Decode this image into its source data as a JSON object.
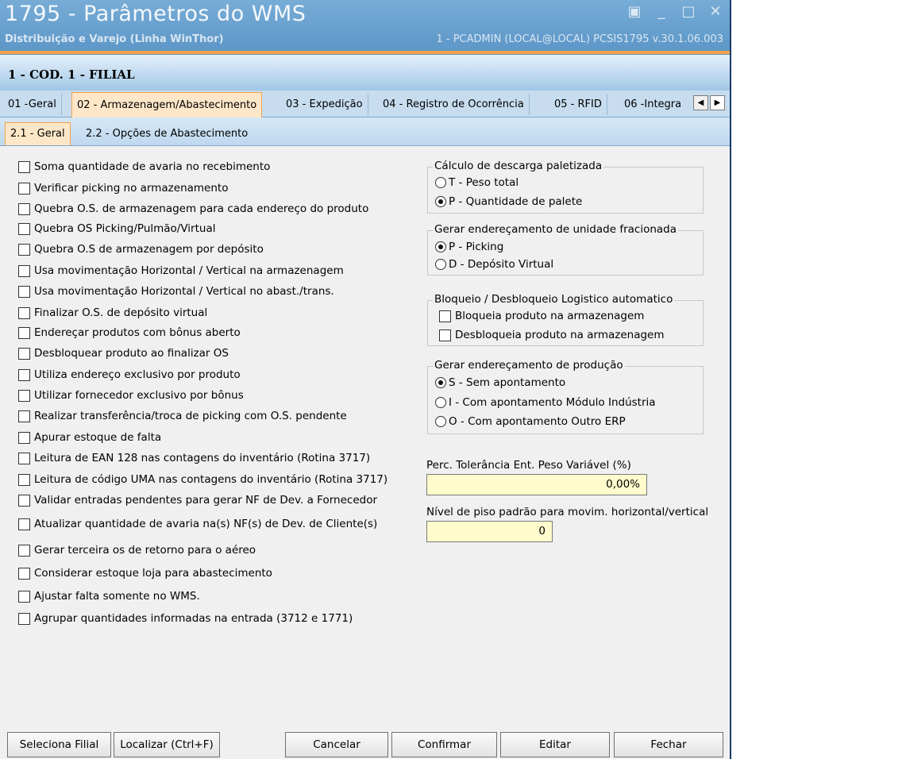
{
  "window": {
    "title": "1795 - Parâmetros do WMS",
    "subtitle": "Distribuição e Varejo (Linha WinThor)",
    "user_info": "1 - PCADMIN (LOCAL@LOCAL)   PCSIS1795  v.30.1.06.003",
    "controls": [
      "▣",
      "_",
      "□",
      "✕"
    ]
  },
  "header": {
    "filial": "1 - COD. 1 - FILIAL"
  },
  "tabs": [
    "01 -Geral",
    "02 - Armazenagem/Abastecimento",
    "03 - Expedição",
    "04 - Registro de Ocorrência",
    "05 - RFID",
    "06 -Integra"
  ],
  "tab_scroll": [
    "◀",
    "▶"
  ],
  "subtabs": [
    "2.1 - Geral",
    "2.2 - Opções de Abastecimento"
  ],
  "checkboxes": [
    "Soma quantidade de avaria no recebimento",
    "Verificar picking no armazenamento",
    "Quebra O.S. de armazenagem para cada endereço do produto",
    "Quebra OS Picking/Pulmão/Virtual",
    "Quebra O.S de armazenagem por depósito",
    "Usa movimentação Horizontal / Vertical na armazenagem",
    "Usa movimentação Horizontal / Vertical no abast./trans.",
    "Finalizar O.S. de depósito virtual",
    "Endereçar produtos com bônus aberto",
    "Desbloquear produto ao finalizar OS",
    "Utiliza endereço exclusivo por produto",
    "Utilizar fornecedor exclusivo por bônus",
    "Realizar transferência/troca de picking com O.S. pendente",
    "Apurar estoque de falta",
    "Leitura de EAN 128 nas contagens do inventário (Rotina 3717)",
    "Leitura de código UMA nas contagens do inventário (Rotina 3717)",
    "Validar entradas pendentes para gerar NF de Dev. a Fornecedor",
    "Atualizar quantidade de avaria na(s) NF(s) de Dev. de Cliente(s)",
    "Gerar terceira os de retorno para o aéreo",
    "Considerar estoque loja para abastecimento",
    "Ajustar falta somente no WMS.",
    "Agrupar quantidades informadas na entrada (3712 e 1771)"
  ],
  "groups": {
    "descarga": {
      "legend": "Cálculo de descarga paletizada",
      "options": [
        "T - Peso total",
        "P - Quantidade de palete"
      ],
      "selected": "P - Quantidade de palete"
    },
    "fracionada": {
      "legend": "Gerar endereçamento de unidade fracionada",
      "options": [
        "P - Picking",
        "D - Depósito Virtual"
      ],
      "selected": "P - Picking"
    },
    "bloqueio": {
      "legend": "Bloqueio / Desbloqueio Logistico automatico",
      "checks": [
        "Bloqueia produto na armazenagem",
        "Desbloqueia produto na armazenagem"
      ]
    },
    "producao": {
      "legend": "Gerar endereçamento de produção",
      "options": [
        "S - Sem apontamento",
        "I - Com apontamento Módulo Indústria",
        "O - Com apontamento Outro ERP"
      ],
      "selected": "S - Sem apontamento"
    }
  },
  "fields": {
    "tolerancia_label": "Perc. Tolerância Ent. Peso Variável (%)",
    "tolerancia_value": "0,00%",
    "piso_label": "Nível de piso padrão para movim. horizontal/vertical",
    "piso_value": "0"
  },
  "buttons": [
    "Seleciona Filial",
    "Localizar (Ctrl+F)",
    "Cancelar",
    "Confirmar",
    "Editar",
    "Fechar"
  ],
  "colors": {
    "titlebar": "#6aa2cf",
    "accent": "#f7a24a",
    "field_bg": "#fffbcc"
  }
}
